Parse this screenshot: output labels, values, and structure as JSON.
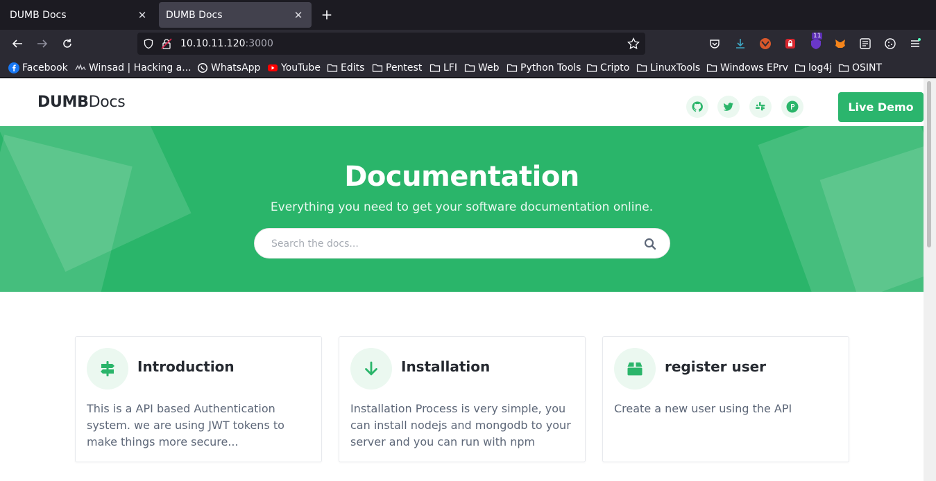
{
  "browser": {
    "tabs": [
      {
        "title": "DUMB Docs",
        "active": false
      },
      {
        "title": "DUMB Docs",
        "active": true
      }
    ],
    "new_tab_label": "+",
    "url": {
      "host": "10.10.11.120",
      "port": ":3000"
    },
    "extension_badge_count": "11",
    "bookmarks": [
      {
        "label": "Facebook",
        "icon": "facebook-icon"
      },
      {
        "label": "Winsad | Hacking a...",
        "icon": "winsad-icon"
      },
      {
        "label": "WhatsApp",
        "icon": "whatsapp-icon"
      },
      {
        "label": "YouTube",
        "icon": "youtube-icon"
      },
      {
        "label": "Edits",
        "icon": "folder-icon"
      },
      {
        "label": "Pentest",
        "icon": "folder-icon"
      },
      {
        "label": "LFI",
        "icon": "folder-icon"
      },
      {
        "label": "Web",
        "icon": "folder-icon"
      },
      {
        "label": "Python Tools",
        "icon": "folder-icon"
      },
      {
        "label": "Cripto",
        "icon": "folder-icon"
      },
      {
        "label": "LinuxTools",
        "icon": "folder-icon"
      },
      {
        "label": "Windows EPrv",
        "icon": "folder-icon"
      },
      {
        "label": "log4j",
        "icon": "folder-icon"
      },
      {
        "label": "OSINT",
        "icon": "folder-icon"
      }
    ]
  },
  "site": {
    "logo_bold": "DUMB",
    "logo_light": "Docs",
    "social": [
      "github-icon",
      "twitter-icon",
      "slack-icon",
      "product-hunt-icon"
    ],
    "live_demo_label": "Live Demo",
    "hero": {
      "title": "Documentation",
      "subtitle": "Everything you need to get your software documentation online.",
      "search_placeholder": "Search the docs..."
    },
    "cards": [
      {
        "title": "Introduction",
        "text": "This is a API based Authentication system. we are using JWT tokens to make things more secure...",
        "icon": "signs-post-icon"
      },
      {
        "title": "Installation",
        "text": "Installation Process is very simple, you can install nodejs and mongodb to your server and you can run with npm",
        "icon": "arrow-down-icon"
      },
      {
        "title": "register user",
        "text": "Create a new user using the API",
        "icon": "box-icon"
      }
    ]
  },
  "colors": {
    "brand_green": "#2ab56a",
    "icon_bg": "#ebf8f0",
    "browser_dark": "#1c1b22",
    "browser_toolbar": "#2b2a33"
  }
}
